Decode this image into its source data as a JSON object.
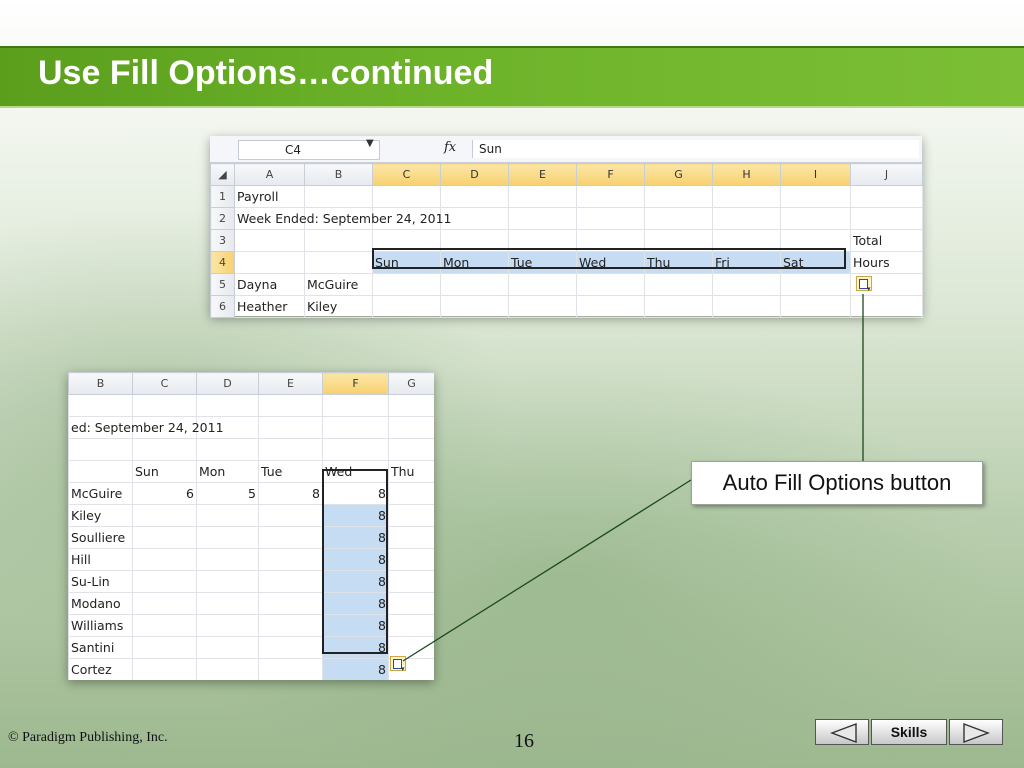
{
  "slide": {
    "title": "Use Fill Options…continued",
    "copyright": "© Paradigm Publishing, Inc.",
    "page_number": "16",
    "nav": {
      "prev_icon": "left-arrow-icon",
      "skills_label": "Skills",
      "next_icon": "right-arrow-icon"
    },
    "callout": "Auto Fill Options button"
  },
  "sheet1": {
    "name_box": "C4",
    "fx": "fx",
    "formula": "Sun",
    "columns": [
      "A",
      "B",
      "C",
      "D",
      "E",
      "F",
      "G",
      "H",
      "I",
      "J"
    ],
    "rows": [
      {
        "n": "1",
        "cells": [
          "Payroll",
          "",
          "",
          "",
          "",
          "",
          "",
          "",
          "",
          ""
        ]
      },
      {
        "n": "2",
        "cells": [
          "Week Ended: September 24, 2011",
          "",
          "",
          "",
          "",
          "",
          "",
          "",
          "",
          ""
        ]
      },
      {
        "n": "3",
        "cells": [
          "",
          "",
          "",
          "",
          "",
          "",
          "",
          "",
          "",
          "Total"
        ]
      },
      {
        "n": "4",
        "cells": [
          "",
          "",
          "Sun",
          "Mon",
          "Tue",
          "Wed",
          "Thu",
          "Fri",
          "Sat",
          "Hours"
        ]
      },
      {
        "n": "5",
        "cells": [
          "Dayna",
          "McGuire",
          "",
          "",
          "",
          "",
          "",
          "",
          "",
          ""
        ]
      },
      {
        "n": "6",
        "cells": [
          "Heather",
          "Kiley",
          "",
          "",
          "",
          "",
          "",
          "",
          "",
          ""
        ]
      }
    ]
  },
  "sheet2": {
    "columns": [
      "B",
      "C",
      "D",
      "E",
      "F",
      "G"
    ],
    "week_label": "ed: September 24, 2011",
    "day_headers": [
      "Sun",
      "Mon",
      "Tue",
      "Wed",
      "Thu"
    ],
    "rows": [
      {
        "name": "McGuire",
        "c": "6",
        "d": "5",
        "e": "8",
        "f": "8"
      },
      {
        "name": "Kiley",
        "c": "",
        "d": "",
        "e": "",
        "f": "8"
      },
      {
        "name": "Soulliere",
        "c": "",
        "d": "",
        "e": "",
        "f": "8"
      },
      {
        "name": "Hill",
        "c": "",
        "d": "",
        "e": "",
        "f": "8"
      },
      {
        "name": "Su-Lin",
        "c": "",
        "d": "",
        "e": "",
        "f": "8"
      },
      {
        "name": "Modano",
        "c": "",
        "d": "",
        "e": "",
        "f": "8"
      },
      {
        "name": "Williams",
        "c": "",
        "d": "",
        "e": "",
        "f": "8"
      },
      {
        "name": "Santini",
        "c": "",
        "d": "",
        "e": "",
        "f": "8"
      },
      {
        "name": "Cortez",
        "c": "",
        "d": "",
        "e": "",
        "f": "8"
      }
    ]
  }
}
